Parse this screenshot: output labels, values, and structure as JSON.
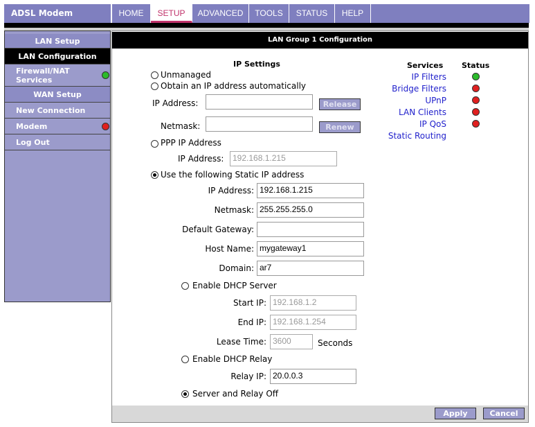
{
  "app": {
    "title": "ADSL Modem"
  },
  "nav": {
    "tabs": [
      "HOME",
      "SETUP",
      "ADVANCED",
      "TOOLS",
      "STATUS",
      "HELP"
    ],
    "active": "SETUP"
  },
  "sidebar": {
    "items": [
      {
        "label": "LAN Setup"
      },
      {
        "label": "LAN Configuration"
      },
      {
        "label": "Firewall/NAT Services",
        "status": "green"
      },
      {
        "label": "WAN Setup"
      },
      {
        "label": "New Connection"
      },
      {
        "label": "Modem",
        "status": "red"
      },
      {
        "label": "Log Out"
      }
    ]
  },
  "main": {
    "header": "LAN Group 1 Configuration",
    "ip_settings": {
      "title": "IP Settings",
      "unmanaged": "Unmanaged",
      "obtain_auto": "Obtain an IP address automatically",
      "ip_address_label": "IP Address:",
      "netmask_label": "Netmask:",
      "release_btn": "Release",
      "renew_btn": "Renew",
      "ppp_ip": "PPP IP Address",
      "ppp_ip_label": "IP Address:",
      "ppp_ip_value": "192.168.1.215",
      "static_ip": "Use the following Static IP address",
      "static": {
        "ip_label": "IP Address:",
        "ip_value": "192.168.1.215",
        "netmask_label": "Netmask:",
        "netmask_value": "255.255.255.0",
        "gateway_label": "Default Gateway:",
        "gateway_value": "",
        "host_label": "Host Name:",
        "host_value": "mygateway1",
        "domain_label": "Domain:",
        "domain_value": "ar7"
      },
      "dhcp_server": "Enable DHCP Server",
      "start_ip_label": "Start IP:",
      "start_ip_value": "192.168.1.2",
      "end_ip_label": "End IP:",
      "end_ip_value": "192.168.1.254",
      "lease_label": "Lease Time:",
      "lease_value": "3600",
      "lease_unit": "Seconds",
      "dhcp_relay": "Enable DHCP Relay",
      "relay_ip_label": "Relay IP:",
      "relay_ip_value": "20.0.0.3",
      "server_relay_off": "Server and Relay Off",
      "selected_mode": "static",
      "selected_dhcp": "off"
    },
    "services": {
      "title": "Services",
      "status_title": "Status",
      "items": [
        {
          "label": "IP Filters",
          "status": "green"
        },
        {
          "label": "Bridge Filters",
          "status": "red"
        },
        {
          "label": "UPnP",
          "status": "red"
        },
        {
          "label": "LAN Clients",
          "status": "red"
        },
        {
          "label": "IP QoS",
          "status": "red"
        },
        {
          "label": "Static Routing",
          "status": null
        }
      ]
    },
    "buttons": {
      "apply": "Apply",
      "cancel": "Cancel"
    }
  },
  "colors": {
    "accent": "#7f7fbf",
    "sidebar": "#9b9bcb",
    "active_tab": "#c0336b",
    "status_green": "#2bbb2b",
    "status_red": "#e02020"
  }
}
